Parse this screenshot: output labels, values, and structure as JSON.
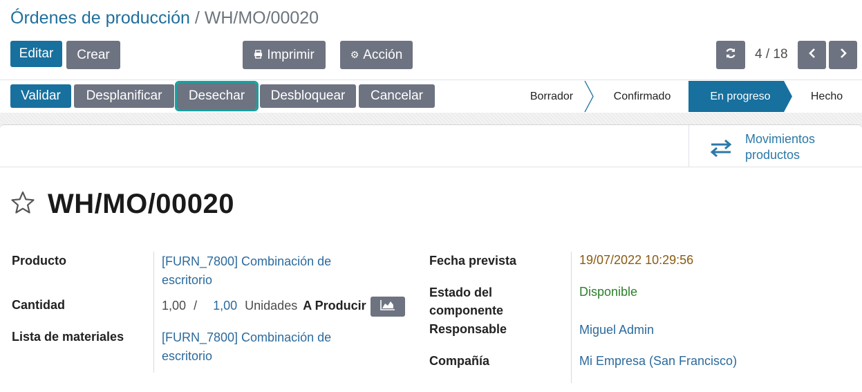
{
  "breadcrumb": {
    "parent": "Órdenes de producción",
    "separator": " / ",
    "current": "WH/MO/00020"
  },
  "control": {
    "edit": "Editar",
    "create": "Crear",
    "print": "Imprimir",
    "action": "Acción"
  },
  "pager": {
    "value": "4 / 18"
  },
  "actions": {
    "validate": "Validar",
    "unplan": "Desplanificar",
    "scrap": "Desechar",
    "unlock": "Desbloquear",
    "cancel": "Cancelar"
  },
  "status": {
    "steps": [
      "Borrador",
      "Confirmado",
      "En progreso",
      "Hecho"
    ],
    "active": "En progreso"
  },
  "smart_button": {
    "line1": "Movimientos",
    "line2": "productos",
    "icon": "transfer-arrows-icon"
  },
  "record": {
    "title": "WH/MO/00020",
    "product_label": "Producto",
    "product_line1": "[FURN_7800] Combinación de",
    "product_line2": "escritorio",
    "quantity_label": "Cantidad",
    "qty_produced": "1,00",
    "qty_sep": "/",
    "qty_target": "1,00",
    "uom": "Unidades",
    "to_produce": "A Producir",
    "bom_label": "Lista de materiales",
    "bom_line1": "[FURN_7800] Combinación de",
    "bom_line2": "escritorio",
    "date_label": "Fecha prevista",
    "date_value": "19/07/2022 10:29:56",
    "component_label_1": "Estado del",
    "component_label_2": "componente",
    "component_value": "Disponible",
    "responsible_label": "Responsable",
    "responsible_value": "Miguel Admin",
    "company_label": "Compañía",
    "company_value": "Mi Empresa (San Francisco)"
  },
  "colors": {
    "primary": "#17709e",
    "secondary": "#6e7381",
    "link": "#2b6a9d",
    "highlight": "#17a1a0",
    "date": "#8a5a12",
    "success": "#2b7f2b"
  }
}
